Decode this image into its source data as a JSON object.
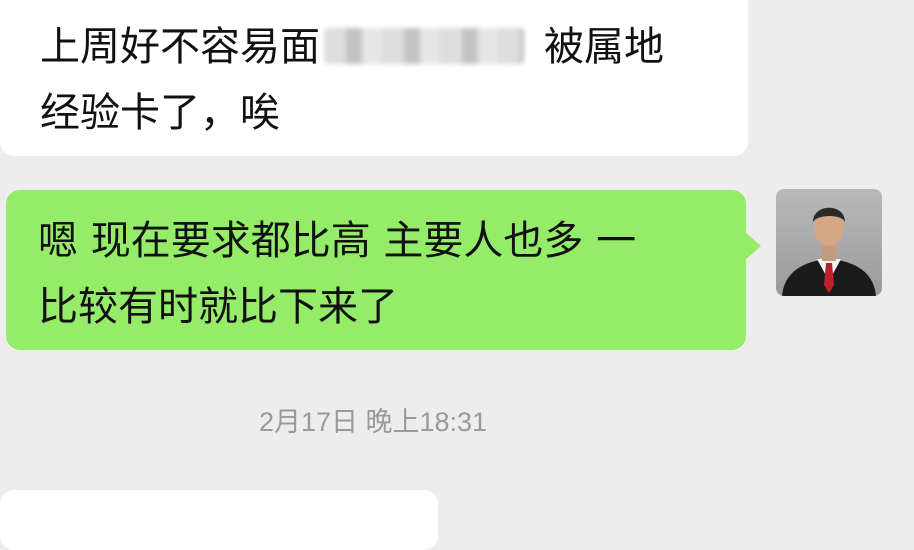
{
  "chat": {
    "messages": [
      {
        "direction": "incoming",
        "line1_before": "上周好不容易面",
        "line1_after": "被属地",
        "line2": "经验卡了，唉"
      },
      {
        "direction": "outgoing",
        "line1": "嗯 现在要求都比高 主要人也多 一",
        "line2": "比较有时就比下来了"
      }
    ],
    "timestamp": "2月17日 晚上18:31"
  },
  "colors": {
    "background": "#ededed",
    "incoming_bubble": "#ffffff",
    "outgoing_bubble": "#95ec69",
    "timestamp_text": "#9a9a9a"
  }
}
